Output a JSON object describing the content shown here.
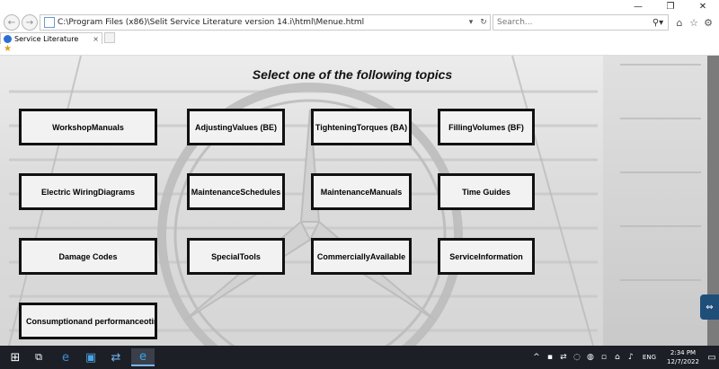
{
  "window": {
    "minimize_icon": "minimize-icon",
    "maximize_icon": "restore-icon",
    "close_icon": "close-icon"
  },
  "browser": {
    "address": "C:\\Program Files (x86)\\Selit Service Literature version 14.i\\html\\Menue.html",
    "search_placeholder": "Search...",
    "tab_title": "Service Literature"
  },
  "content": {
    "heading": "Select one of the following topics",
    "topics": [
      "WorkshopManuals",
      "AdjustingValues (BE)",
      "TighteningTorques (BA)",
      "FillingVolumes (BF)",
      "Electric WiringDiagrams",
      "MaintenanceSchedules",
      "MaintenanceManuals",
      "Time Guides",
      "Damage Codes",
      "SpecialTools",
      "CommerciallyAvailable",
      "ServiceInformation",
      "Consumptionand performanceotin"
    ]
  },
  "taskbar": {
    "language": "ENG",
    "time": "2:34 PM",
    "date": "12/7/2022"
  },
  "colors": {
    "button_border": "#111111",
    "button_fill": "#f2f2f2",
    "taskbar": "#1c1f26"
  }
}
